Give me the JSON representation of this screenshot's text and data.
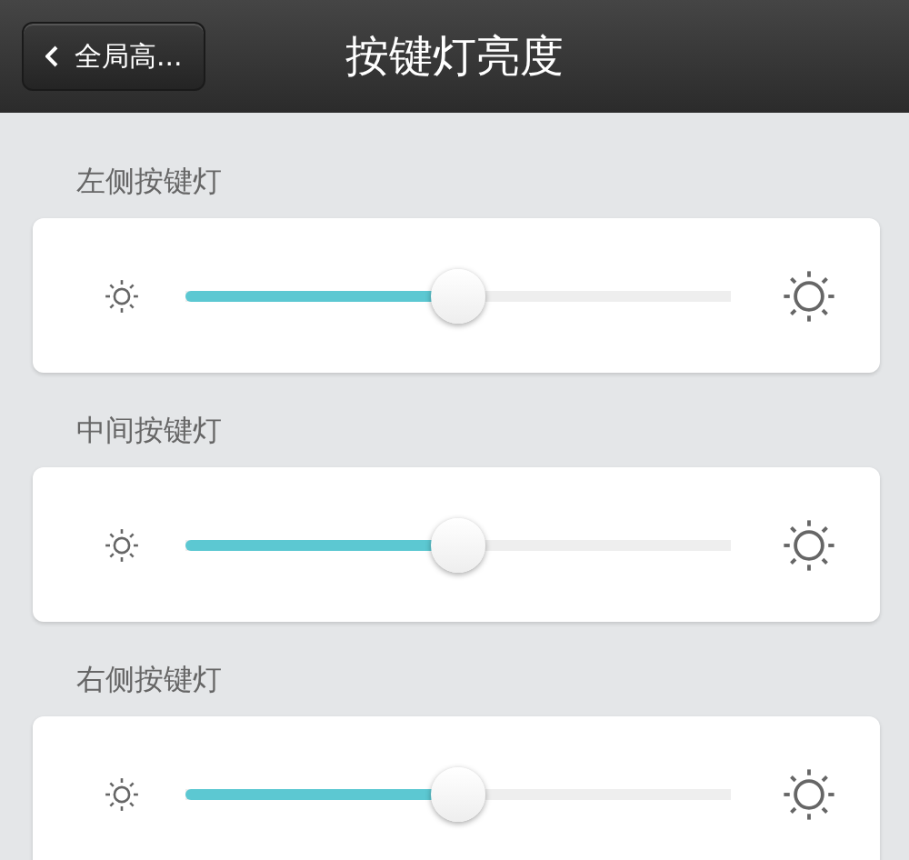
{
  "header": {
    "back_button": "全局高...",
    "title": "按键灯亮度"
  },
  "sliders": [
    {
      "label": "左侧按键灯",
      "level": 0.5
    },
    {
      "label": "中间按键灯",
      "level": 0.5
    },
    {
      "label": "右侧按键灯",
      "level": 0.5
    }
  ]
}
